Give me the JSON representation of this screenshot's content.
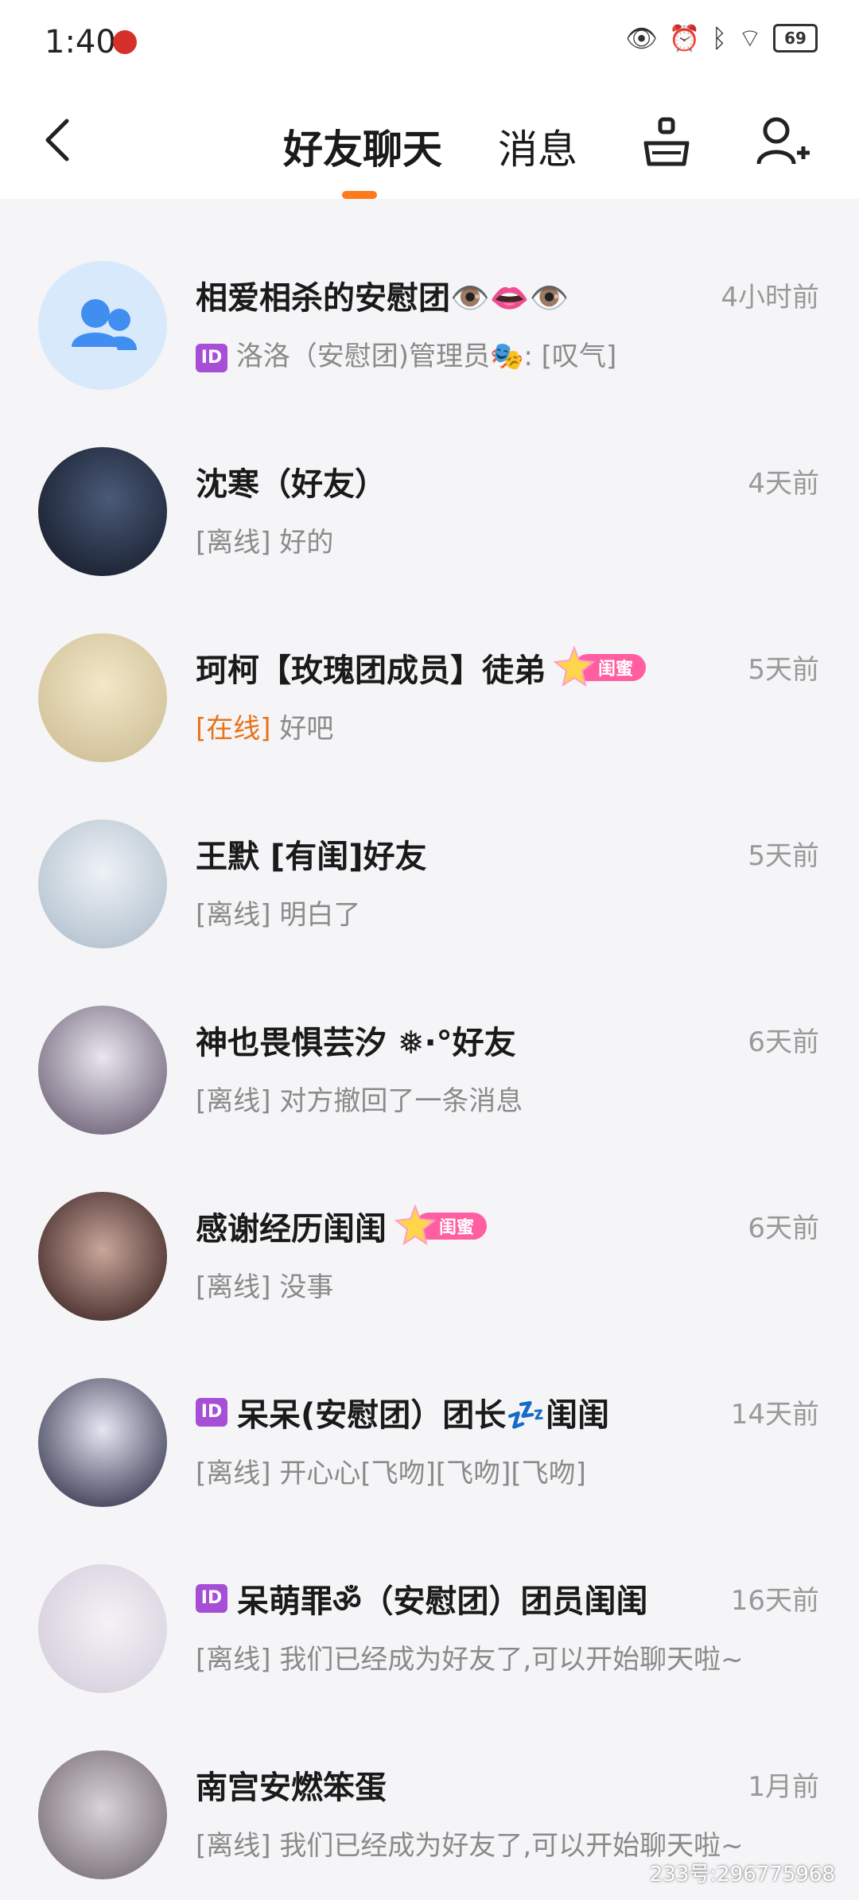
{
  "status": {
    "time": "1:40",
    "battery": "69"
  },
  "header": {
    "tab_friends": "好友聊天",
    "tab_messages": "消息"
  },
  "chats": [
    {
      "name": "相爱相杀的安慰团👁️👄👁️",
      "time": "4小时前",
      "preview_prefix": "",
      "preview_text": "洛洛（安慰团)管理员🎭: [叹气]",
      "id_chip": true,
      "avatar_type": "group"
    },
    {
      "name": "沈寒（好友）",
      "time": "4天前",
      "preview_prefix": "[离线]",
      "preview_text": "好的"
    },
    {
      "name": "珂柯【玫瑰团成员】徒弟",
      "time": "5天前",
      "preview_prefix": "[在线]",
      "preview_text": "好吧",
      "badge": "闺蜜"
    },
    {
      "name": "王默 [有闺]好友",
      "time": "5天前",
      "preview_prefix": "[离线]",
      "preview_text": "明白了"
    },
    {
      "name": "神也畏惧芸汐 ❅·°好友",
      "time": "6天前",
      "preview_prefix": "[离线]",
      "preview_text": "对方撤回了一条消息"
    },
    {
      "name": "感谢经历闺闺",
      "time": "6天前",
      "preview_prefix": "[离线]",
      "preview_text": "没事",
      "badge": "闺蜜"
    },
    {
      "name": "呆呆(安慰团）团长💤闺闺",
      "time": "14天前",
      "preview_prefix": "[离线]",
      "preview_text": "开心心[飞吻][飞吻][飞吻]",
      "id_chip": true
    },
    {
      "name": "呆萌罪ॐ（安慰团）团员闺闺",
      "time": "16天前",
      "preview_prefix": "[离线]",
      "preview_text": "我们已经成为好友了,可以开始聊天啦~",
      "id_chip": true
    },
    {
      "name": "南宫安燃笨蛋",
      "time": "1月前",
      "preview_prefix": "[离线]",
      "preview_text": "我们已经成为好友了,可以开始聊天啦~"
    }
  ],
  "watermark": "233号:296775968",
  "colors": {
    "accent": "#ff7a1a",
    "online": "#e8731a",
    "badge": "#ff5fa2"
  }
}
